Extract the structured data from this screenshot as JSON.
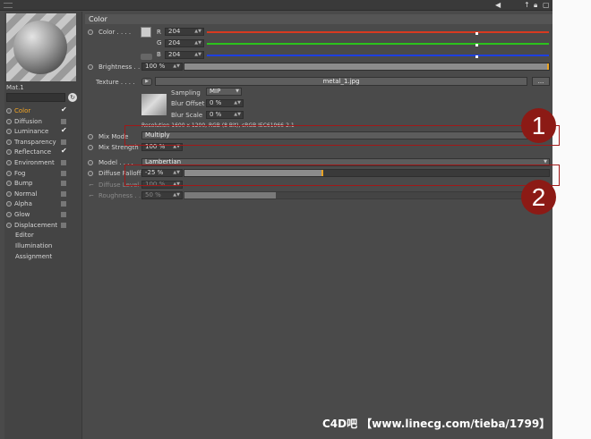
{
  "channels": [
    {
      "name": "Color",
      "state": "tick",
      "active": true
    },
    {
      "name": "Diffusion",
      "state": "box"
    },
    {
      "name": "Luminance",
      "state": "tick"
    },
    {
      "name": "Transparency",
      "state": "box"
    },
    {
      "name": "Reflectance",
      "state": "tick"
    },
    {
      "name": "Environment",
      "state": "box"
    },
    {
      "name": "Fog",
      "state": "box"
    },
    {
      "name": "Bump",
      "state": "box"
    },
    {
      "name": "Normal",
      "state": "box"
    },
    {
      "name": "Alpha",
      "state": "box"
    },
    {
      "name": "Glow",
      "state": "box"
    },
    {
      "name": "Displacement",
      "state": "box"
    }
  ],
  "extra_items": [
    "Editor",
    "Illumination",
    "Assignment"
  ],
  "material_name": "Mat.1",
  "section_title": "Color",
  "color": {
    "label": "Color . . . .",
    "r_label": "R",
    "g_label": "G",
    "b_label": "B",
    "r": "204",
    "g": "204",
    "b": "204",
    "r_color": "#d83a20",
    "g_color": "#2cc21c",
    "b_color": "#1e3fe0"
  },
  "brightness": {
    "label": "Brightness . .",
    "value": "100 %",
    "level": 1.0
  },
  "texture": {
    "label": "Texture . . . .",
    "file": "metal_1.jpg",
    "more_btn": "...",
    "sampling_label": "Sampling",
    "sampling_value": "MIP",
    "blur_offset_label": "Blur Offset",
    "blur_offset_value": "0 %",
    "blur_scale_label": "Blur Scale",
    "blur_scale_value": "0 %",
    "resolution": "Resolution 1600 x 1200, RGB (8 Bit), sRGB IEC61966-2.1"
  },
  "mix_mode": {
    "label": "Mix Mode",
    "value": "Multiply"
  },
  "mix_strength": {
    "label": "Mix Strength",
    "value": "100 %"
  },
  "model": {
    "label": "Model . . . .",
    "value": "Lambertian"
  },
  "diffuse_falloff": {
    "label": "Diffuse Falloff",
    "value": "-25 %",
    "level": 0.25
  },
  "diffuse_level": {
    "label": "Diffuse Level",
    "value": "100 %"
  },
  "roughness": {
    "label": "Roughness . .",
    "value": "50 %",
    "level": 0.5
  },
  "annotations": [
    "1",
    "2"
  ],
  "watermark": "C4D吧 【www.linecg.com/tieba/1799】",
  "accent": "#f6a623"
}
